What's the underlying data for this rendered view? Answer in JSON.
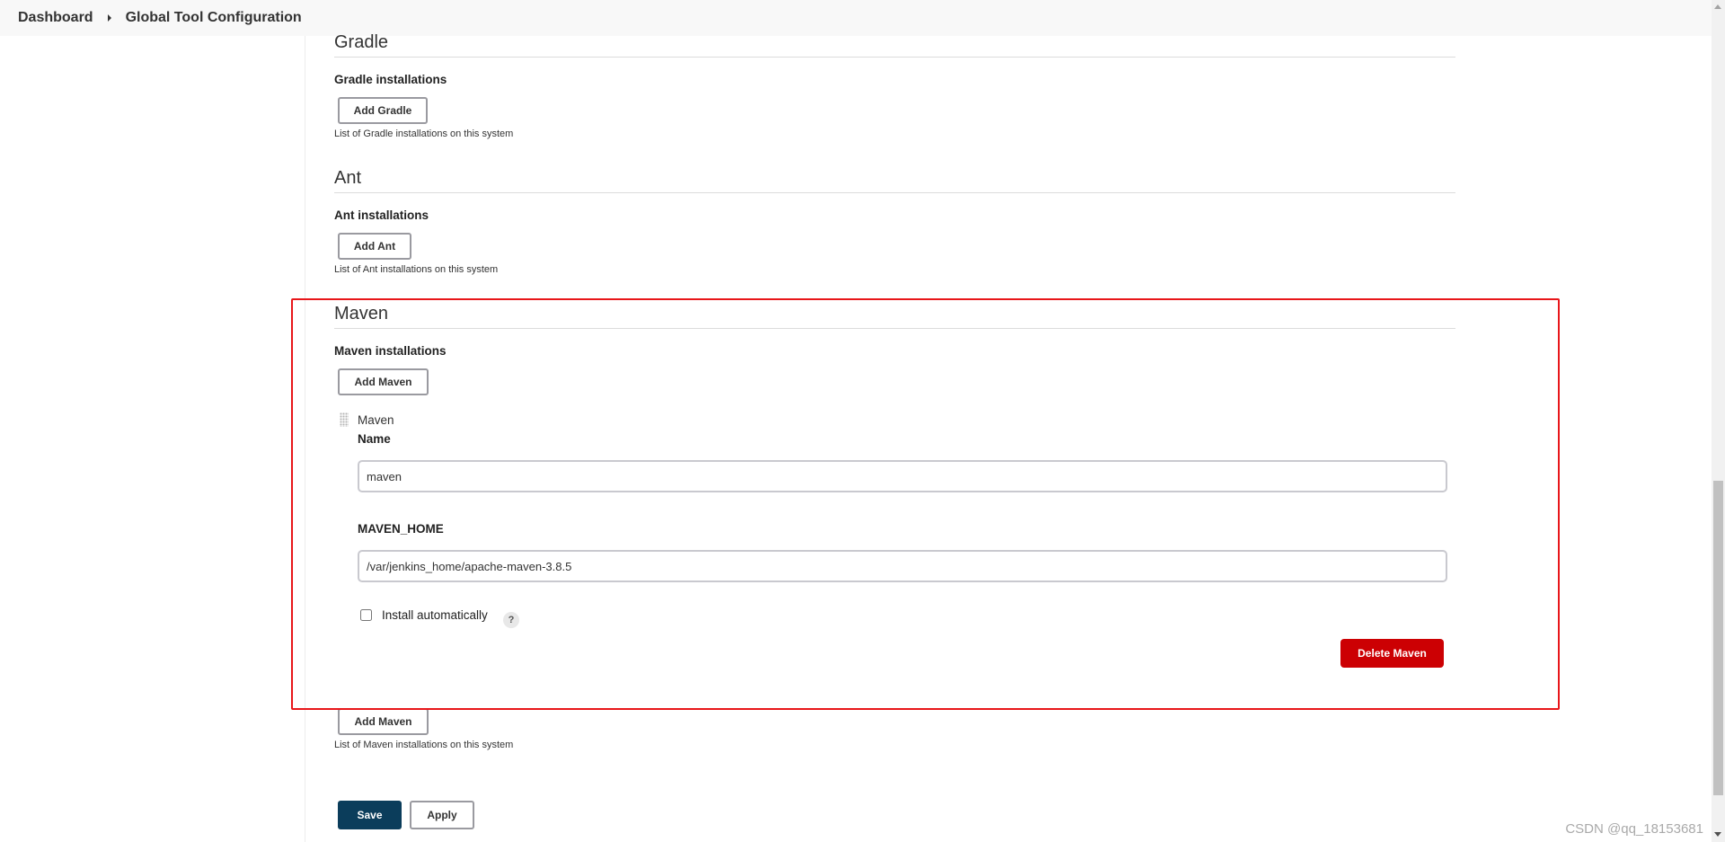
{
  "breadcrumb": {
    "items": [
      "Dashboard",
      "Global Tool Configuration"
    ]
  },
  "gradle": {
    "title": "Gradle",
    "installations_label": "Gradle installations",
    "add_button": "Add Gradle",
    "help": "List of Gradle installations on this system"
  },
  "ant": {
    "title": "Ant",
    "installations_label": "Ant installations",
    "add_button": "Add Ant",
    "help": "List of Ant installations on this system"
  },
  "maven": {
    "title": "Maven",
    "installations_label": "Maven installations",
    "add_button_top": "Add Maven",
    "installation": {
      "header": "Maven",
      "name_label": "Name",
      "name_value": "maven",
      "home_label": "MAVEN_HOME",
      "home_value": "/var/jenkins_home/apache-maven-3.8.5",
      "install_auto_label": "Install automatically",
      "install_auto_checked": false,
      "help_glyph": "?",
      "delete_button": "Delete Maven"
    },
    "add_button_bottom": "Add Maven",
    "help": "List of Maven installations on this system"
  },
  "actions": {
    "save": "Save",
    "apply": "Apply"
  },
  "watermark": "CSDN @qq_18153681",
  "colors": {
    "highlight": "#e8161a",
    "delete": "#cc0003",
    "save": "#0b3d5b"
  },
  "icons": {
    "breadcrumb_separator": "caret-right-icon",
    "drag": "drag-handle-icon",
    "help": "help-icon"
  }
}
